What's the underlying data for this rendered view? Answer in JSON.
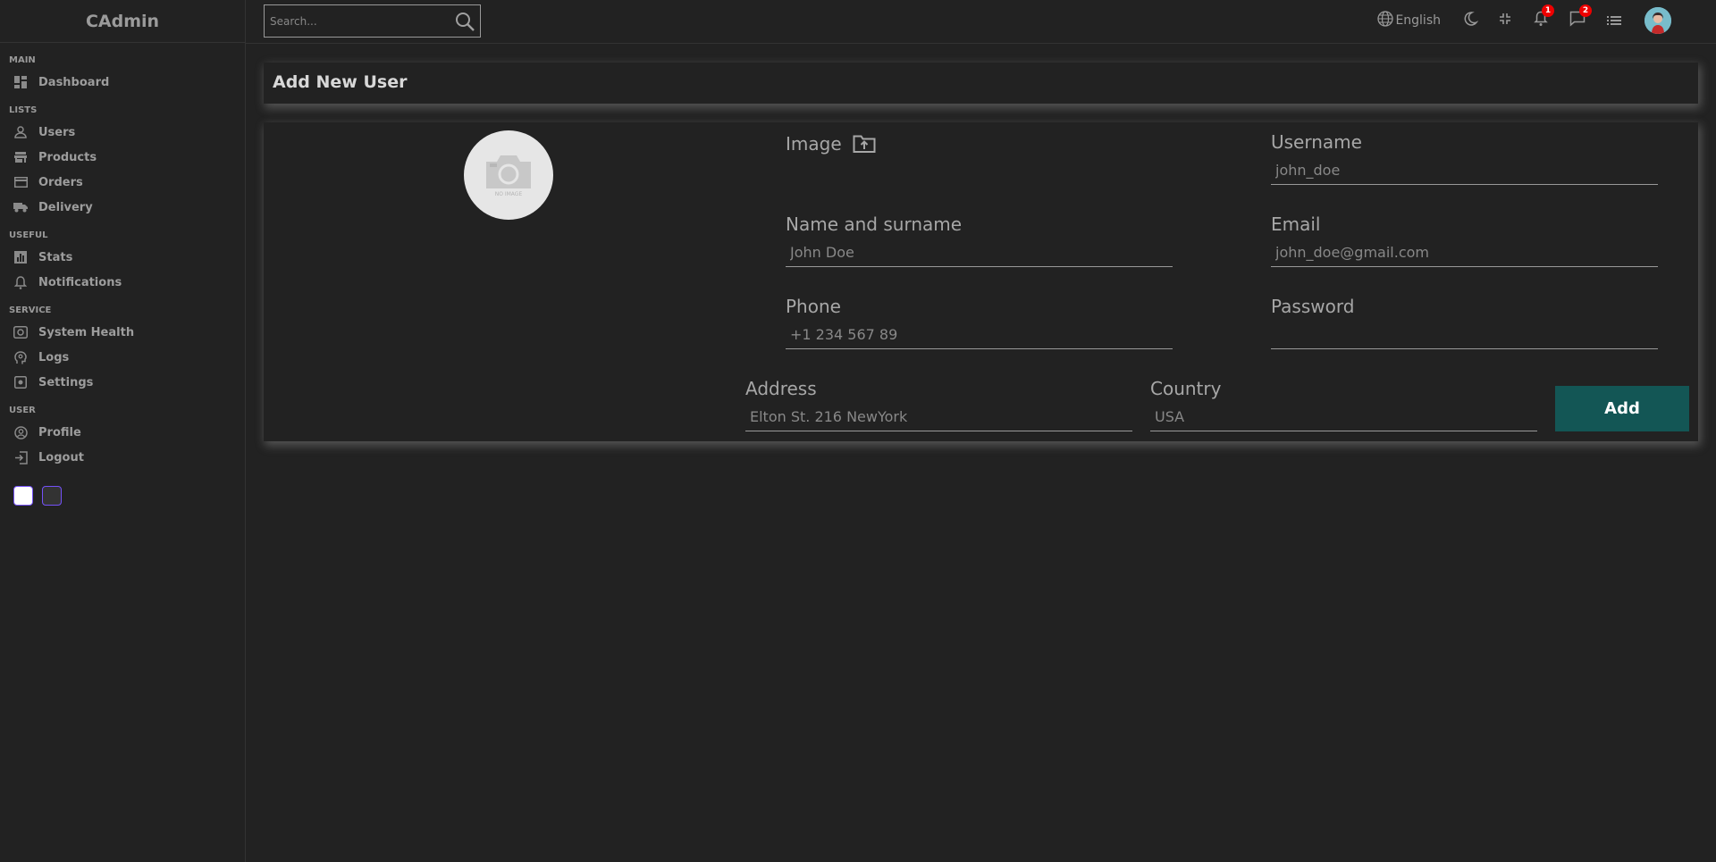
{
  "app": {
    "logo": "CAdmin"
  },
  "search": {
    "placeholder": "Search..."
  },
  "sidebar": {
    "sections": [
      {
        "title": "MAIN",
        "items": [
          {
            "label": "Dashboard",
            "icon": "dashboard-icon"
          }
        ]
      },
      {
        "title": "LISTS",
        "items": [
          {
            "label": "Users",
            "icon": "user-icon"
          },
          {
            "label": "Products",
            "icon": "store-icon"
          },
          {
            "label": "Orders",
            "icon": "credit-card-icon"
          },
          {
            "label": "Delivery",
            "icon": "truck-icon"
          }
        ]
      },
      {
        "title": "USEFUL",
        "items": [
          {
            "label": "Stats",
            "icon": "stats-icon"
          },
          {
            "label": "Notifications",
            "icon": "bell-icon"
          }
        ]
      },
      {
        "title": "SERVICE",
        "items": [
          {
            "label": "System Health",
            "icon": "system-health-icon"
          },
          {
            "label": "Logs",
            "icon": "psychology-icon"
          },
          {
            "label": "Settings",
            "icon": "settings-icon"
          }
        ]
      },
      {
        "title": "USER",
        "items": [
          {
            "label": "Profile",
            "icon": "account-circle-icon"
          },
          {
            "label": "Logout",
            "icon": "logout-icon"
          }
        ]
      }
    ],
    "themes": [
      {
        "name": "light",
        "color": "#ffffff"
      },
      {
        "name": "dark",
        "color": "#333333"
      }
    ]
  },
  "topbar": {
    "language": "English",
    "notifications_count": "1",
    "messages_count": "2"
  },
  "page": {
    "title": "Add New User",
    "image_label": "Image",
    "no_image_text": "NO IMAGE",
    "fields": {
      "username": {
        "label": "Username",
        "placeholder": "john_doe"
      },
      "name": {
        "label": "Name and surname",
        "placeholder": "John Doe"
      },
      "email": {
        "label": "Email",
        "placeholder": "john_doe@gmail.com"
      },
      "phone": {
        "label": "Phone",
        "placeholder": "+1 234 567 89"
      },
      "password": {
        "label": "Password",
        "placeholder": ""
      },
      "address": {
        "label": "Address",
        "placeholder": "Elton St. 216 NewYork"
      },
      "country": {
        "label": "Country",
        "placeholder": "USA"
      }
    },
    "add_button": "Add"
  },
  "colors": {
    "background": "#222222",
    "button": "#135655",
    "badge": "#ee0000",
    "theme_accent": "#7451f8"
  }
}
